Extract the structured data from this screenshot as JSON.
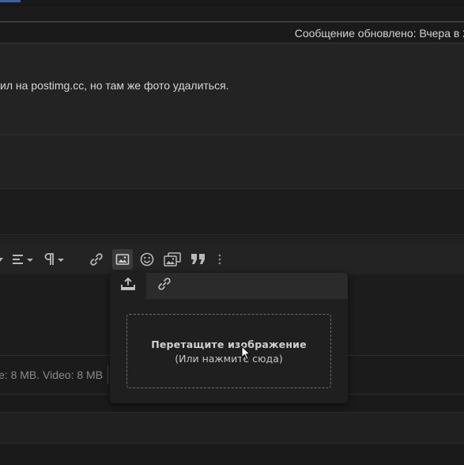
{
  "post": {
    "edited_label": "Сообщение обновлено: Вчера в 2",
    "body_text": "ил на postimg.cc, но там же фото удалиться."
  },
  "toolbar": {
    "icons": [
      "align-icon",
      "paragraph-icon",
      "link-icon",
      "image-icon",
      "smiley-icon",
      "media-gallery-icon",
      "quote-icon",
      "more-icon"
    ]
  },
  "attachments": {
    "limits_text": "e: 8 MB. Video: 8 MB"
  },
  "image_popup": {
    "tabs": [
      "upload-icon",
      "link-icon"
    ],
    "dropzone_title": "Перетащите изображение",
    "dropzone_subtitle": "(Или нажмите сюда)"
  },
  "colors": {
    "background": "#1b1b1b",
    "popup": "#1f1f1f",
    "active_tab": "#2b2b2b",
    "accent": "#3f5f9a"
  }
}
